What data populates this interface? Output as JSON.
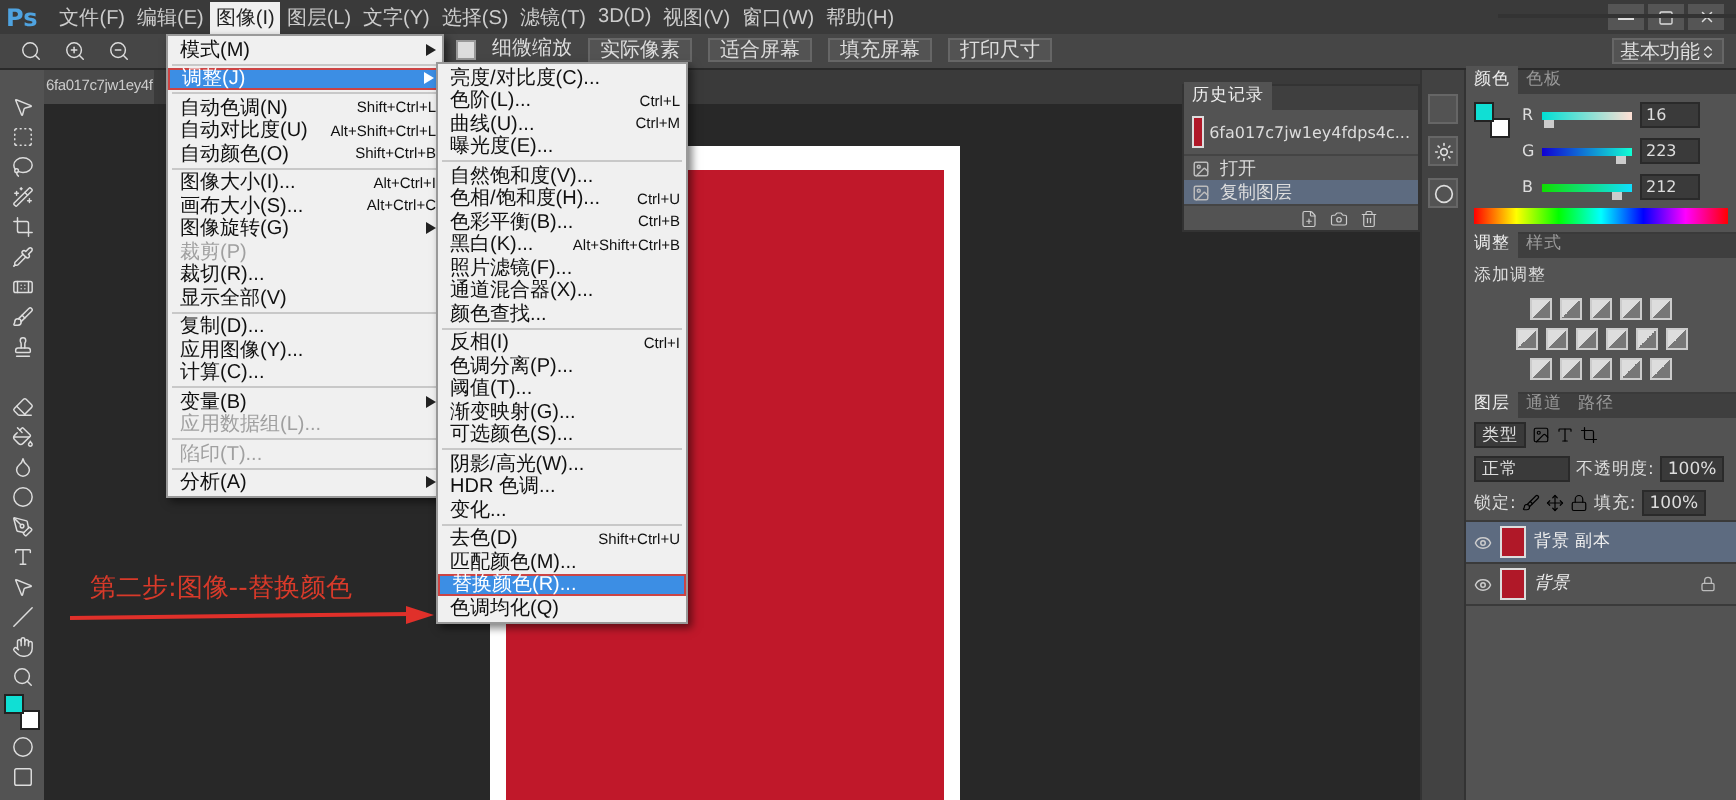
{
  "app_logo": "Ps",
  "menu_bar": [
    {
      "label": "文件(F)",
      "selected": false
    },
    {
      "label": "编辑(E)",
      "selected": false
    },
    {
      "label": "图像(I)",
      "selected": true
    },
    {
      "label": "图层(L)",
      "selected": false
    },
    {
      "label": "文字(Y)",
      "selected": false
    },
    {
      "label": "选择(S)",
      "selected": false
    },
    {
      "label": "滤镜(T)",
      "selected": false
    },
    {
      "label": "3D(D)",
      "selected": false
    },
    {
      "label": "视图(V)",
      "selected": false
    },
    {
      "label": "窗口(W)",
      "selected": false
    },
    {
      "label": "帮助(H)",
      "selected": false
    }
  ],
  "options_bar": {
    "fine_zoom": {
      "label": "细微缩放",
      "checked": true
    },
    "buttons": [
      "实际像素",
      "适合屏幕",
      "填充屏幕",
      "打印尺寸"
    ],
    "workspace": "基本功能"
  },
  "document_tab": "6fa017c7jw1ey4f",
  "image_menu": [
    [
      {
        "label": "模式(M)",
        "selected": false,
        "disabled": false,
        "submenu": true
      }
    ],
    [
      {
        "label": "调整(J)",
        "selected": true,
        "disabled": false,
        "submenu": true
      }
    ],
    [
      {
        "label": "自动色调(N)",
        "shortcut": "Shift+Ctrl+L",
        "selected": false,
        "disabled": false,
        "submenu": false
      },
      {
        "label": "自动对比度(U)",
        "shortcut": "Alt+Shift+Ctrl+L",
        "selected": false,
        "disabled": false,
        "submenu": false
      },
      {
        "label": "自动颜色(O)",
        "shortcut": "Shift+Ctrl+B",
        "selected": false,
        "disabled": false,
        "submenu": false
      }
    ],
    [
      {
        "label": "图像大小(I)...",
        "shortcut": "Alt+Ctrl+I",
        "selected": false,
        "disabled": false,
        "submenu": false
      },
      {
        "label": "画布大小(S)...",
        "shortcut": "Alt+Ctrl+C",
        "selected": false,
        "disabled": false,
        "submenu": false
      },
      {
        "label": "图像旋转(G)",
        "selected": false,
        "disabled": false,
        "submenu": true
      },
      {
        "label": "裁剪(P)",
        "selected": false,
        "disabled": true,
        "submenu": false
      },
      {
        "label": "裁切(R)...",
        "selected": false,
        "disabled": false,
        "submenu": false
      },
      {
        "label": "显示全部(V)",
        "selected": false,
        "disabled": false,
        "submenu": false
      }
    ],
    [
      {
        "label": "复制(D)...",
        "selected": false,
        "disabled": false,
        "submenu": false
      },
      {
        "label": "应用图像(Y)...",
        "selected": false,
        "disabled": false,
        "submenu": false
      },
      {
        "label": "计算(C)...",
        "selected": false,
        "disabled": false,
        "submenu": false
      }
    ],
    [
      {
        "label": "变量(B)",
        "selected": false,
        "disabled": false,
        "submenu": true
      },
      {
        "label": "应用数据组(L)...",
        "selected": false,
        "disabled": true,
        "submenu": false
      }
    ],
    [
      {
        "label": "陷印(T)...",
        "selected": false,
        "disabled": true,
        "submenu": false
      }
    ],
    [
      {
        "label": "分析(A)",
        "selected": false,
        "disabled": false,
        "submenu": true
      }
    ]
  ],
  "adjust_submenu": [
    [
      {
        "label": "亮度/对比度(C)...",
        "selected": false
      },
      {
        "label": "色阶(L)...",
        "shortcut": "Ctrl+L",
        "selected": false
      },
      {
        "label": "曲线(U)...",
        "shortcut": "Ctrl+M",
        "selected": false
      },
      {
        "label": "曝光度(E)...",
        "selected": false
      }
    ],
    [
      {
        "label": "自然饱和度(V)...",
        "selected": false
      },
      {
        "label": "色相/饱和度(H)...",
        "shortcut": "Ctrl+U",
        "selected": false
      },
      {
        "label": "色彩平衡(B)...",
        "shortcut": "Ctrl+B",
        "selected": false
      },
      {
        "label": "黑白(K)...",
        "shortcut": "Alt+Shift+Ctrl+B",
        "selected": false
      },
      {
        "label": "照片滤镜(F)...",
        "selected": false
      },
      {
        "label": "通道混合器(X)...",
        "selected": false
      },
      {
        "label": "颜色查找...",
        "selected": false
      }
    ],
    [
      {
        "label": "反相(I)",
        "shortcut": "Ctrl+I",
        "selected": false
      },
      {
        "label": "色调分离(P)...",
        "selected": false
      },
      {
        "label": "阈值(T)...",
        "selected": false
      },
      {
        "label": "渐变映射(G)...",
        "selected": false
      },
      {
        "label": "可选颜色(S)...",
        "selected": false
      }
    ],
    [
      {
        "label": "阴影/高光(W)...",
        "selected": false
      },
      {
        "label": "HDR 色调...",
        "selected": false
      },
      {
        "label": "变化...",
        "selected": false
      }
    ],
    [
      {
        "label": "去色(D)",
        "shortcut": "Shift+Ctrl+U",
        "selected": false
      },
      {
        "label": "匹配颜色(M)...",
        "selected": false
      },
      {
        "label": "替换颜色(R)...",
        "selected": true
      },
      {
        "label": "色调均化(Q)",
        "selected": false
      }
    ]
  ],
  "annotation": "第二步:图像--替换颜色",
  "history_panel": {
    "title": "历史记录",
    "snapshot": "6fa017c7jw1ey4fdps4c...",
    "items": [
      {
        "label": "打开",
        "selected": false
      },
      {
        "label": "复制图层",
        "selected": true
      }
    ]
  },
  "color_panel": {
    "tabs": [
      {
        "label": "颜色",
        "selected": true
      },
      {
        "label": "色板",
        "selected": false
      }
    ],
    "channels": [
      {
        "name": "R",
        "level": 0.06,
        "reading": "16"
      },
      {
        "name": "G",
        "level": 0.87,
        "reading": "223"
      },
      {
        "name": "B",
        "level": 0.83,
        "reading": "212"
      }
    ]
  },
  "adjustments_panel": {
    "tabs": [
      {
        "label": "调整",
        "selected": true
      },
      {
        "label": "样式",
        "selected": false
      }
    ],
    "title": "添加调整"
  },
  "layers_panel": {
    "tabs": [
      {
        "label": "图层",
        "selected": true
      },
      {
        "label": "通道",
        "selected": false
      },
      {
        "label": "路径",
        "selected": false
      }
    ],
    "filter": "类型",
    "blend_mode": "正常",
    "opacity_label": "不透明度:",
    "opacity": "100%",
    "lock_label": "锁定:",
    "fill_label": "填充:",
    "fill": "100%",
    "layers": [
      {
        "name": "背景 副本",
        "selected": true,
        "locked": false
      },
      {
        "name": "背景",
        "selected": false,
        "locked": true
      }
    ]
  }
}
